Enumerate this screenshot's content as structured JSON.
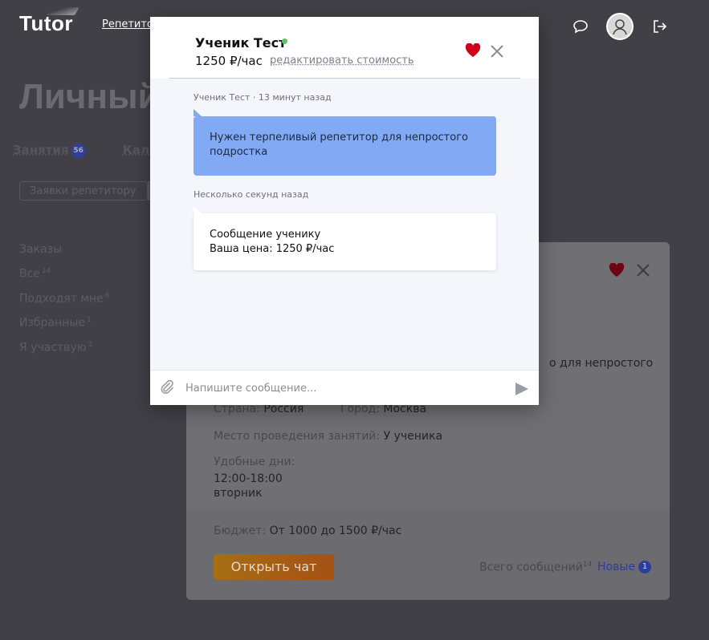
{
  "header": {
    "logo": "Tutor",
    "nav_item": "Репетитор",
    "icons": [
      "chat-bubble-icon",
      "avatar",
      "logout-icon"
    ]
  },
  "page": {
    "title": "Личный",
    "tabs": [
      {
        "label": "Занятия",
        "badge": "56"
      },
      {
        "label": "Кале"
      }
    ],
    "request_button": "Заявки репетитору"
  },
  "filters": {
    "heading": "Заказы",
    "items": [
      {
        "label": "Все",
        "count": "14"
      },
      {
        "label": "Подходят мне",
        "count": "6"
      },
      {
        "label": "Избранные",
        "count": "1"
      },
      {
        "label": "Я участвую",
        "count": "3"
      }
    ]
  },
  "card": {
    "desc_tail": "о для непростого",
    "country_label": "Страна:",
    "country": "Россия",
    "city_label": "Город:",
    "city": "Москва",
    "place_label": "Место проведения занятий:",
    "place": "У ученика",
    "days_label": "Удобные дни:",
    "days_time": "12:00-18:00",
    "days_day": "вторник",
    "budget_label": "Бюджет:",
    "budget": "От 1000 до 1500 ₽/час",
    "open_chat": "Открыть чат",
    "total_label": "Всего сообщений",
    "total_count": "14",
    "new_label": "Новые",
    "new_count": "1"
  },
  "chat": {
    "peer_name": "Ученик Тест",
    "price": "1250 ₽/час",
    "edit_price": "редактировать стоимость",
    "messages": [
      {
        "meta": "Ученик Тест · 13 минут назад",
        "text": "Нужен терпеливый репетитор для непростого подростка"
      },
      {
        "meta": "Несколько секунд назад",
        "line1": "Сообщение ученику",
        "line2": "Ваша цена: 1250 ₽/час"
      }
    ],
    "input_placeholder": "Напишите сообщение..."
  },
  "colors": {
    "accent_heart": "#d0021b",
    "incoming_bubble": "#81a9f4",
    "online": "#5cc46a"
  }
}
